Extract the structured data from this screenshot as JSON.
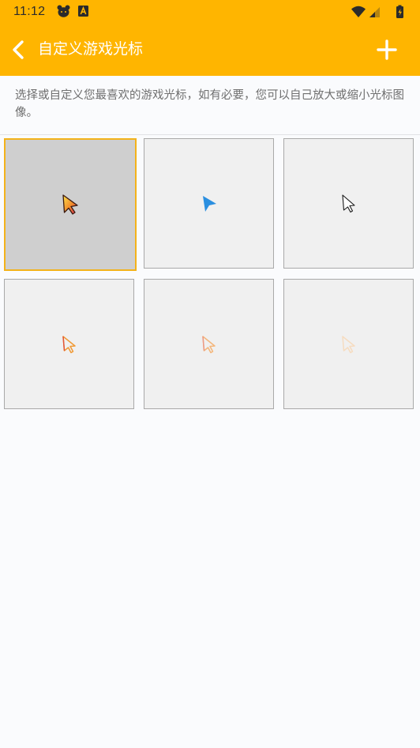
{
  "status_bar": {
    "time": "11:12",
    "icons": [
      "bear-app-icon",
      "a-box-app-icon",
      "wifi-icon",
      "signal-icon",
      "battery-icon"
    ]
  },
  "app_bar": {
    "title": "自定义游戏光标",
    "back_icon": "chevron-left-icon",
    "add_icon": "plus-icon",
    "color": "#ffb500"
  },
  "description": "选择或自定义您最喜欢的游戏光标，如有必要，您可以自己放大或缩小光标图像。",
  "cursors": [
    {
      "name": "cursor-gradient-red-yellow",
      "selected": true
    },
    {
      "name": "cursor-solid-blue",
      "selected": false
    },
    {
      "name": "cursor-white-outline",
      "selected": false
    },
    {
      "name": "cursor-orange-outline",
      "selected": false
    },
    {
      "name": "cursor-light-orange-outline",
      "selected": false
    },
    {
      "name": "cursor-faint-outline",
      "selected": false
    }
  ],
  "colors": {
    "accent": "#ffb500",
    "selected_border": "#f3b21a",
    "cursor_blue": "#2b8fe0"
  }
}
